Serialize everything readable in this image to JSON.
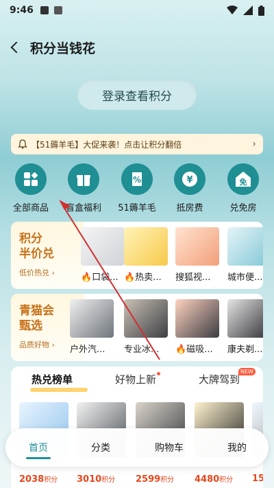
{
  "status": {
    "time": "9:46"
  },
  "header": {
    "title": "积分当钱花"
  },
  "login_button": "登录查看积分",
  "notice": {
    "text": "【51薅羊毛】大促来袭！点击让积分翻倍",
    "arrow": "›"
  },
  "categories": [
    {
      "label": "全部商品",
      "icon": "grid-icon"
    },
    {
      "label": "盲盒福利",
      "icon": "gift-box-icon"
    },
    {
      "label": "51薅羊毛",
      "icon": "percent-icon"
    },
    {
      "label": "抵房费",
      "icon": "yuan-icon"
    },
    {
      "label": "兑免房",
      "icon": "free-room-icon",
      "glyph": "免"
    }
  ],
  "card1": {
    "title_line1": "积分",
    "title_line2": "半价兑",
    "subtitle": "低价热兑 ›",
    "products": [
      "🔥口袋...",
      "🔥热卖...",
      "搜狐视...",
      "城市便..."
    ]
  },
  "card2": {
    "title_line1": "青猫会",
    "title_line2": "甄选",
    "subtitle": "品质好物 ›",
    "products": [
      "户外汽...",
      "专业冰...",
      "🔥磁吸...",
      "康夫剃..."
    ]
  },
  "tabs": {
    "items": [
      "热兑榜单",
      "好物上新",
      "大牌驾到"
    ],
    "new_badge": "NEW"
  },
  "goods": [
    {
      "price": "2038",
      "unit": "积分"
    },
    {
      "price": "3010",
      "unit": "积分"
    },
    {
      "price": "2599",
      "unit": "积分"
    },
    {
      "price": "4480",
      "unit": "积分"
    },
    {
      "price": "15",
      "unit": ""
    }
  ],
  "bottom_nav": [
    "首页",
    "分类",
    "购物车",
    "我的"
  ],
  "colors": {
    "accent": "#1f8f94",
    "price": "#e6461c",
    "card_title": "#c8721b",
    "annotation": "#d32f2f"
  }
}
